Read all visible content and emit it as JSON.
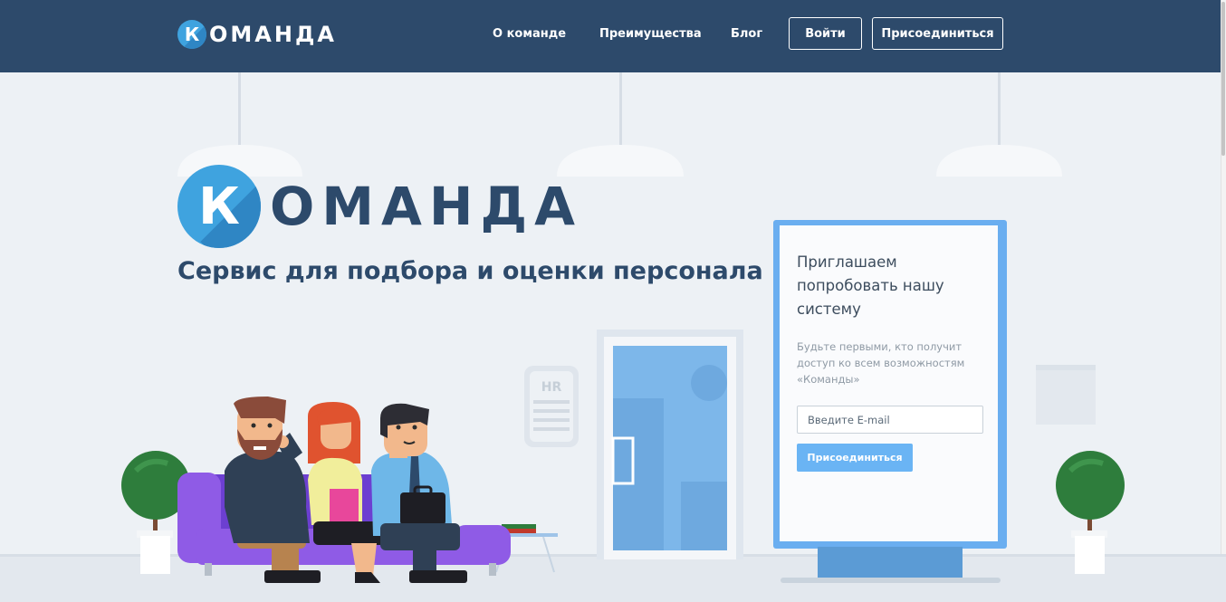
{
  "header": {
    "logo": {
      "letter": "К",
      "word": "ОМАНДА"
    },
    "nav": [
      {
        "id": "about",
        "label": "О команде"
      },
      {
        "id": "features",
        "label": "Преимущества"
      },
      {
        "id": "blog",
        "label": "Блог"
      }
    ],
    "login_label": "Войти",
    "join_label": "Присоединиться"
  },
  "hero": {
    "logo": {
      "letter": "К",
      "word": "ОМАНДА"
    },
    "tagline": "Сервис для подбора и оценки персонала"
  },
  "signup": {
    "title": "Приглашаем попробовать нашу систему",
    "description": "Будьте первыми, кто получит доступ ко всем возможностям «Команды»",
    "email_placeholder": "Введите E-mail",
    "submit_label": "Присоединиться"
  },
  "illustration": {
    "door_sign": "HR"
  },
  "colors": {
    "header_bg": "#2d4a6b",
    "brand_blue": "#3fa3df",
    "page_bg": "#edf1f5",
    "accent_button": "#6ab4f4"
  }
}
